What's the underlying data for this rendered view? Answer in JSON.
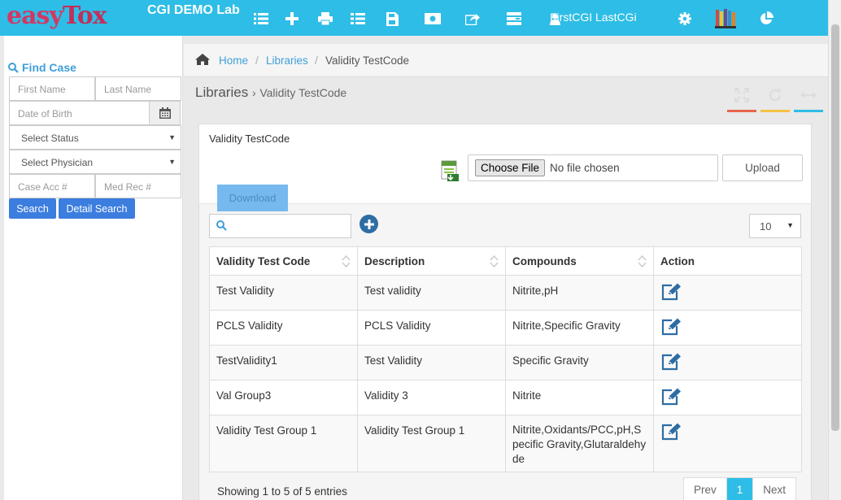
{
  "app": {
    "logo_text_1": "easy",
    "logo_text_2": "Tox",
    "lab_name": "CGI DEMO Lab",
    "user_name": "FirstCGI LastCGi"
  },
  "topbar_icons": [
    "list-icon",
    "plus-icon",
    "print-icon",
    "list-alt-icon",
    "save-icon",
    "money-icon",
    "share-icon",
    "tasks-icon",
    "user-icon",
    "gear-icon",
    "books-icon",
    "pie-chart-icon"
  ],
  "sidebar": {
    "find_case": "Find Case",
    "first_name_placeholder": "First Name",
    "last_name_placeholder": "Last Name",
    "dob_placeholder": "Date of Birth",
    "status_select": "Select Status",
    "physician_select": "Select Physician",
    "case_acc_placeholder": "Case Acc #",
    "med_rec_placeholder": "Med Rec #",
    "search_label": "Search",
    "detail_search_label": "Detail Search"
  },
  "breadcrumb": {
    "home": "Home",
    "sep": "/",
    "libraries": "Libraries",
    "current": "Validity TestCode"
  },
  "page": {
    "title": "Libraries",
    "arrow": "›",
    "subtitle": "Validity TestCode",
    "header_colors": [
      "#e8664d",
      "#f5c242",
      "#2ebde6"
    ]
  },
  "panel": {
    "title": "Validity TestCode",
    "choose_file": "Choose File",
    "no_file": "No file chosen",
    "upload": "Upload",
    "download": "Download",
    "page_size": "10"
  },
  "table": {
    "headers": [
      "Validity Test Code",
      "Description",
      "Compounds",
      "Action"
    ],
    "rows": [
      {
        "code": "Test Validity",
        "description": "Test validity",
        "compounds": "Nitrite,pH"
      },
      {
        "code": "PCLS Validity",
        "description": "PCLS Validity",
        "compounds": "Nitrite,Specific Gravity"
      },
      {
        "code": "TestValidity1",
        "description": "Test Validity",
        "compounds": "Specific Gravity"
      },
      {
        "code": "Val Group3",
        "description": "Validity 3",
        "compounds": "Nitrite"
      },
      {
        "code": "Validity Test Group 1",
        "description": "Validity Test Group 1",
        "compounds": "Nitrite,Oxidants/PCC,pH,Specific Gravity,Glutaraldehyde"
      }
    ]
  },
  "footer": {
    "info": "Showing 1 to 5 of 5 entries",
    "prev": "Prev",
    "page": "1",
    "next": "Next"
  }
}
